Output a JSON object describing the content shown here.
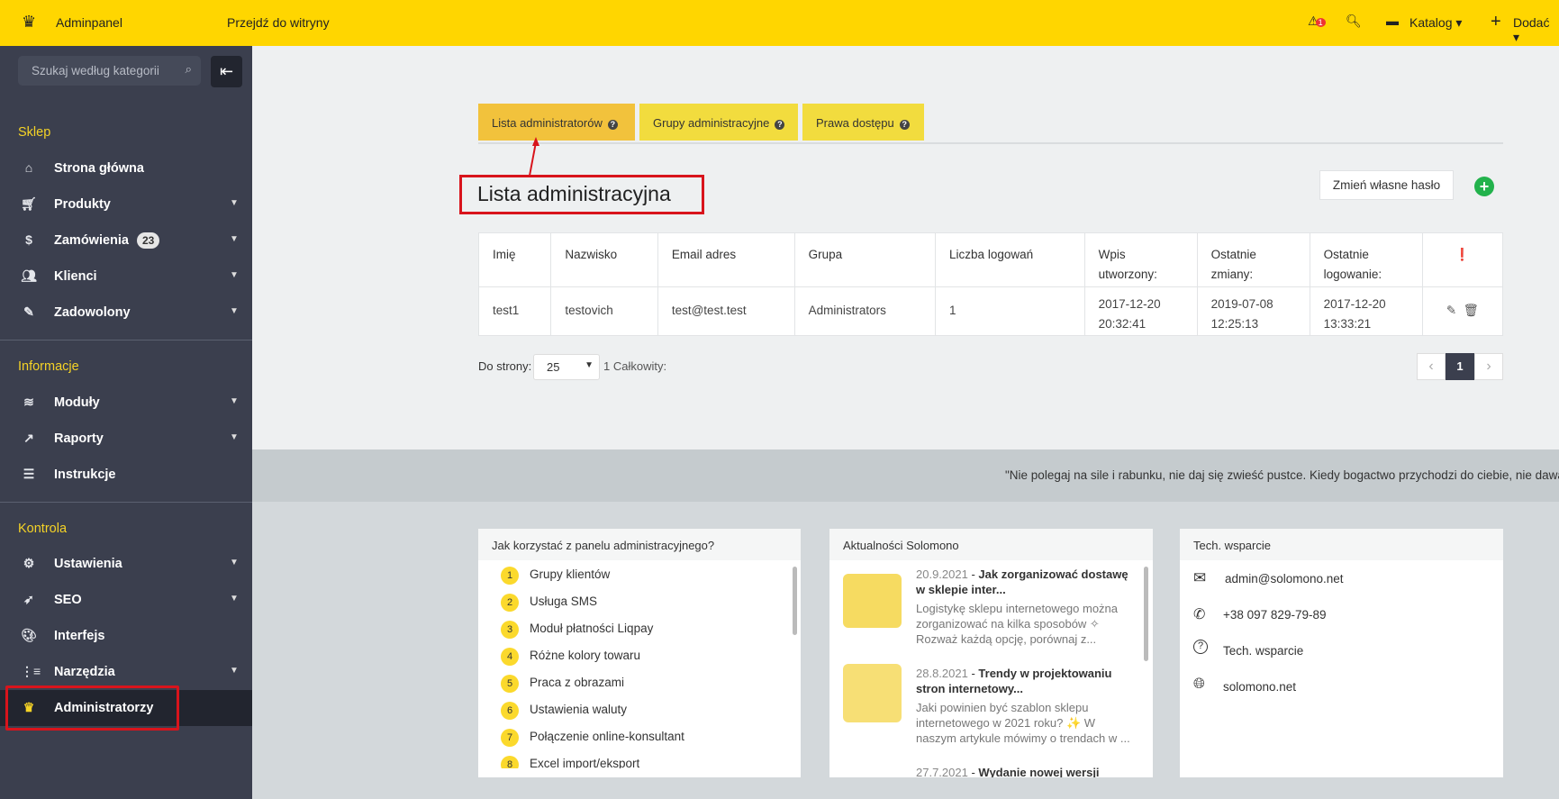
{
  "topbar": {
    "brand": "Adminpanel",
    "visit_site": "Przejdź do witryny",
    "alert_count": "1",
    "catalog": "Katalog",
    "add": "Dodać"
  },
  "sidebar": {
    "search_placeholder": "Szukaj według kategorii",
    "sections": [
      {
        "title": "Sklep",
        "items": [
          {
            "label": "Strona główna"
          },
          {
            "label": "Produkty"
          },
          {
            "label": "Zamówienia",
            "badge": "23"
          },
          {
            "label": "Klienci"
          },
          {
            "label": "Zadowolony"
          }
        ]
      },
      {
        "title": "Informacje",
        "items": [
          {
            "label": "Moduły"
          },
          {
            "label": "Raporty"
          },
          {
            "label": "Instrukcje"
          }
        ]
      },
      {
        "title": "Kontrola",
        "items": [
          {
            "label": "Ustawienia"
          },
          {
            "label": "SEO"
          },
          {
            "label": "Interfejs"
          },
          {
            "label": "Narzędzia"
          },
          {
            "label": "Administratorzy"
          }
        ]
      }
    ]
  },
  "tabs": [
    {
      "label": "Lista administratorów"
    },
    {
      "label": "Grupy administracyjne"
    },
    {
      "label": "Prawa dostępu"
    }
  ],
  "page_title": "Lista administracyjna",
  "change_password": "Zmień własne hasło",
  "table": {
    "headers": [
      "Imię",
      "Nazwisko",
      "Email adres",
      "Grupa",
      "Liczba logowań",
      "Wpis utworzony:",
      "Ostatnie zmiany:",
      "Ostatnie logowanie:"
    ],
    "rows": [
      [
        "test1",
        "testovich",
        "test@test.test",
        "Administrators",
        "1",
        "2017-12-20 20:32:41",
        "2019-07-08 12:25:13",
        "2017-12-20 13:33:21"
      ]
    ]
  },
  "pager": {
    "label": "Do strony:",
    "per_page": "25",
    "total": "1 Całkowity:",
    "current": "1"
  },
  "quote": "\"Nie polegaj na sile i rabunku, nie daj się zwieść pustce. Kiedy bogactwo przychodzi do ciebie, nie dawaj mu",
  "howto": {
    "title": "Jak korzystać z panelu administracyjnego?",
    "items": [
      "Grupy klientów",
      "Usługa SMS",
      "Moduł płatności Liqpay",
      "Różne kolory towaru",
      "Praca z obrazami",
      "Ustawienia waluty",
      "Połączenie online-konsultant",
      "Excel import/eksport"
    ]
  },
  "news": {
    "title": "Aktualności Solomono",
    "items": [
      {
        "date": "20.9.2021",
        "title": "Jak zorganizować dostawę w sklepie inter...",
        "text": "Logistykę sklepu internetowego można zorganizować na kilka sposobów ✧ Rozważ każdą opcję, porównaj z..."
      },
      {
        "date": "28.8.2021",
        "title": "Trendy w projektowaniu stron internetowy...",
        "text": "Jaki powinien być szablon sklepu internetowego w 2021 roku? ✨ W naszym artykule mówimy o trendach w ..."
      },
      {
        "date": "27.7.2021",
        "title": "Wydanie nowej wersji",
        "text": ""
      }
    ]
  },
  "support": {
    "title": "Tech. wsparcie",
    "email": "admin@solomono.net",
    "phone": "+38 097 829-79-89",
    "help": "Tech. wsparcie",
    "site": "solomono.net"
  },
  "colors": {
    "accent": "#ffd600",
    "sidebar": "#3b3f4e",
    "active": "#22252f"
  }
}
